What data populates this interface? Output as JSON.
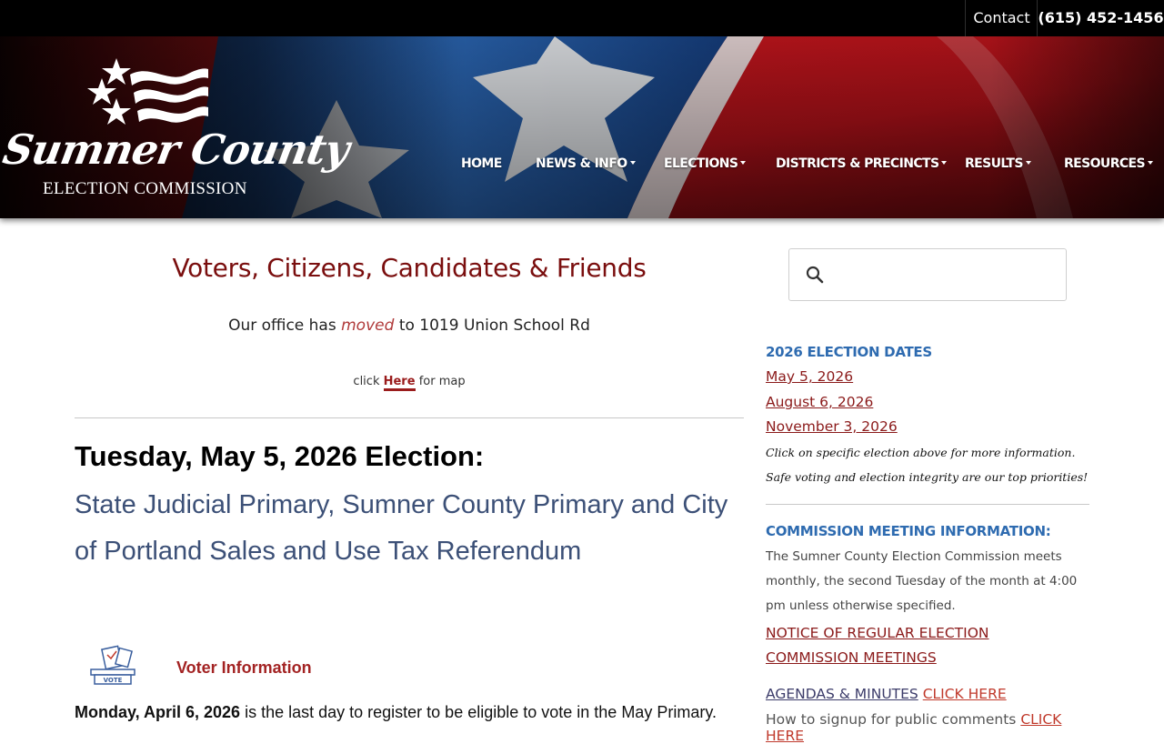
{
  "topbar": {
    "contact_label": "Contact",
    "phone": "(615) 452-1456"
  },
  "logo": {
    "script_text": "Sumner County",
    "sub_text": "ELECTION COMMISSION"
  },
  "nav": {
    "items": [
      {
        "label": "HOME",
        "has_dropdown": false
      },
      {
        "label": "NEWS & INFO",
        "has_dropdown": true
      },
      {
        "label": "ELECTIONS",
        "has_dropdown": true
      },
      {
        "label": "DISTRICTS & PRECINCTS",
        "has_dropdown": true
      },
      {
        "label": "RESULTS",
        "has_dropdown": true
      },
      {
        "label": "RESOURCES",
        "has_dropdown": true
      }
    ]
  },
  "main": {
    "title": "Voters, Citizens, Candidates & Friends",
    "office_prefix": "Our office has",
    "office_moved": "moved",
    "office_suffix": "to 1019 Union School Rd",
    "map_prefix": "click",
    "map_link": "Here",
    "map_suffix": "for map",
    "election_heading": "Tuesday, May 5, 2026 Election:",
    "election_subheading": "State Judicial Primary, Sumner County Primary and City of Portland Sales and Use Tax Referendum",
    "vote_icon_label": "VOTE",
    "voter_info_label": "Voter Information",
    "register_date": "Monday, April 6, 2026",
    "register_text": "is the last day to register to be eligible to vote in the May Primary."
  },
  "search": {
    "placeholder": "",
    "value": ""
  },
  "sidebar": {
    "dates_heading": "2026 ELECTION DATES",
    "dates": [
      "May 5, 2026",
      "August 6, 2026",
      "November 3, 2026"
    ],
    "note_1": "Click on specific election above for more information.",
    "note_2": "Safe voting and election integrity are our top priorities!",
    "meeting_heading": "COMMISSION MEETING INFORMATION:",
    "meeting_text": "The Sumner County Election Commission meets monthly, the second Tuesday of the month at 4:00 pm unless otherwise specified.",
    "notice_link": "NOTICE OF REGULAR ELECTION COMMISSION MEETINGS",
    "agendas_label": "AGENDAS & MINUTES",
    "agendas_link": "CLICK HERE",
    "comments_label": "How to signup for public comments",
    "comments_link": "CLICK HERE"
  },
  "colors": {
    "topbar_bg": "#000000",
    "title_red": "#7a0e0e",
    "link_red": "#8b1a1a",
    "sidebar_heading_blue": "#2e6bb0",
    "subheading_blue": "#3c5077"
  },
  "icons": [
    "search-icon",
    "vote-box-icon",
    "star-icon",
    "chevron-down-icon"
  ]
}
